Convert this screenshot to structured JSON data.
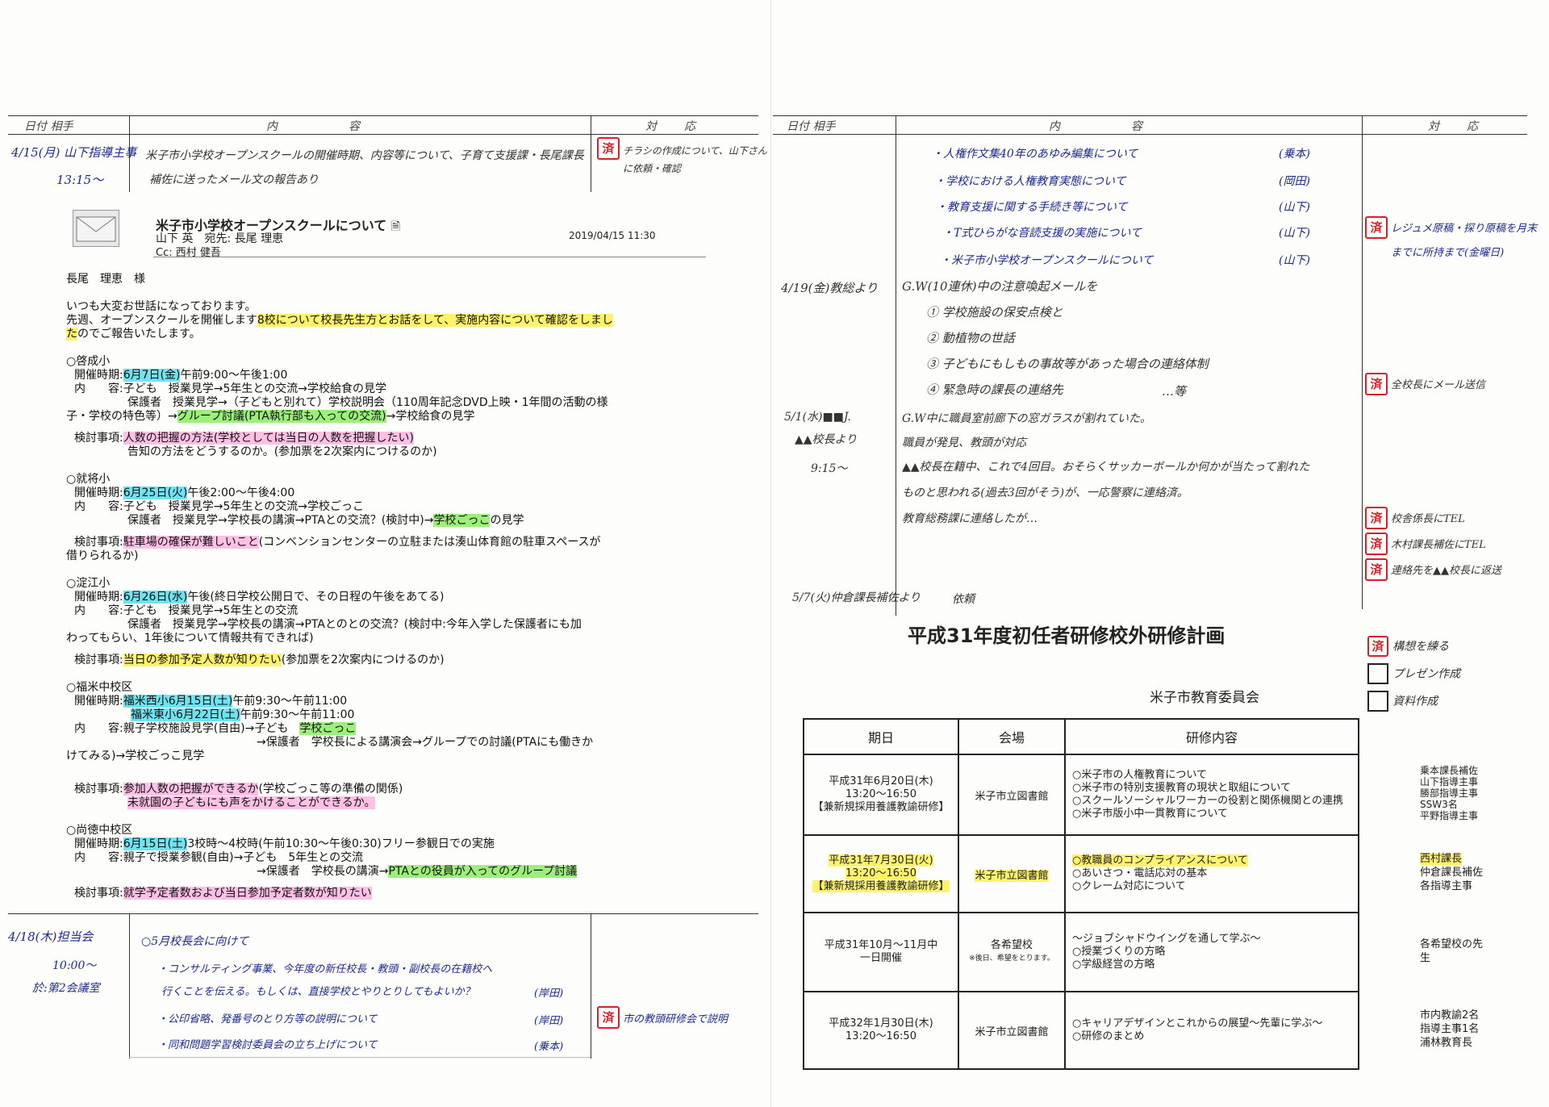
{
  "left": {
    "header": {
      "date": "日付 相手",
      "content": "内　　容",
      "response": "対　応"
    },
    "entry1": {
      "date": "4/15(月) 山下指導主事",
      "time": "13:15～",
      "line1": "米子市小学校オープンスクールの開催時期、内容等について、子育て支援課・長尾課長",
      "line2": "補佐に送ったメール文の報告あり",
      "stamp": "済",
      "resp1": "チラシの作成について、山下さん",
      "resp2": "に依頼・確認"
    },
    "email": {
      "subject": "米子市小学校オープンスクールについて",
      "from": "山下 英　宛先: 長尾 理恵",
      "cc": "Cc: 西村 健吾",
      "datetime": "2019/04/15 11:30",
      "greeting": "長尾　理恵　様",
      "body1": "いつも大変お世話になっております。",
      "body2a": "先週、オープンスクールを開催します",
      "body2b": "8校について校長先生方とお話をして、実施内容について確認をしまし",
      "body3a": "た",
      "body3b": "のでご報告いたします。",
      "s1": {
        "name": "○啓成小",
        "l1a": "開催時期:",
        "l1b": "6月7日(金)",
        "l1c": "午前9:00～午後1:00",
        "l2": "内　　容:子ども　授業見学→5年生との交流→学校給食の見学",
        "l3": "保護者　授業見学→（子どもと別れて）学校説明会（110周年記念DVD上映・1年間の活動の様",
        "l4a": "子・学校の特色等）→",
        "l4b": "グループ討議(PTA執行部も入っての交流)",
        "l4c": "→学校給食の見学",
        "k1a": "検討事項:",
        "k1b": "人数の把握の方法(学校としては当日の人数を把握したい)",
        "k2": "告知の方法をどうするのか。(参加票を2次案内につけるのか)"
      },
      "s2": {
        "name": "○就将小",
        "l1a": "開催時期:",
        "l1b": "6月25日(火)",
        "l1c": "午後2:00～午後4:00",
        "l2": "内　　容:子ども　授業見学→5年生との交流→学校ごっこ",
        "l3a": "保護者　授業見学→学校長の講演→PTAとの交流？(検討中)→",
        "l3b": "学校ごっこ",
        "l3c": "の見学",
        "k1a": "検討事項:",
        "k1b": "駐車場の確保が難しいこと",
        "k1c": "(コンベンションセンターの立駐または湊山体育館の駐車スペースが",
        "k2": "借りられるか)"
      },
      "s3": {
        "name": "○淀江小",
        "l1a": "開催時期:",
        "l1b": "6月26日(水)",
        "l1c": "午後(終日学校公開日で、その日程の午後をあてる)",
        "l2": "内　　容:子ども　授業見学→5年生との交流",
        "l3": "保護者　授業見学→学校長の講演→PTAとのとの交流？(検討中:今年入学した保護者にも加",
        "l4": "わってもらい、1年後について情報共有できれば)",
        "k1a": "検討事項:",
        "k1b": "当日の参加予定人数が知りたい",
        "k1c": "(参加票を2次案内につけるのか)"
      },
      "s4": {
        "name": "○福米中校区",
        "l1a": "開催時期:",
        "l1b": "福米西小6月15日(土)",
        "l1c": "午前9:30～午前11:00",
        "l2a": "福米東小6月22日(土)",
        "l2b": "午前9:30～午前11:00",
        "l3a": "内　　容:親子学校施設見学(自由)→子ども",
        "l3b": "学校ごっこ",
        "l4": "→保護者　学校長による講演会→グループでの討議(PTAにも働きか",
        "l5": "けてみる)→学校ごっこ見学",
        "k1a": "検討事項:",
        "k1b": "参加人数の把握ができるか",
        "k1c": "(学校ごっこ等の準備の関係)",
        "k2": "未就園の子どもにも声をかけることができるか。"
      },
      "s5": {
        "name": "○尚徳中校区",
        "l1a": "開催時期:",
        "l1b": "6月15日(土)",
        "l1c": "3校時～4校時(午前10:30～午後0:30)フリー参観日での実施",
        "l2": "内　　容:親子で授業参観(自由)→子ども　5年生との交流",
        "l3a": "→保護者　学校長の講演→",
        "l3b": "PTAとの役員が入ってのグループ討議",
        "k1a": "検討事項:",
        "k1b": "就学予定者数および当日参加予定者数が知りたい"
      }
    },
    "entry2": {
      "date": "4/18(木)担当会",
      "time": "10:00～",
      "place": "於:第2会議室",
      "title": "○5月校長会に向けて",
      "i1": "・コンサルティング事業、今年度の新任校長・教頭・副校長の在籍校へ",
      "i2": "行くことを伝える。もしくは、直接学校とやりとりしてもよいか？",
      "i2who": "(岸田)",
      "i3": "・公印省略、発番号のとり方等の説明について",
      "i3who": "(岸田)",
      "i4": "・同和問題学習検討委員会の立ち上げについて",
      "i4who": "(乗本)",
      "stamp": "済",
      "resp": "市の教頭研修会で説明"
    }
  },
  "right": {
    "header": {
      "date": "日付 相手",
      "content": "内　　容",
      "response": "対　応"
    },
    "topics": [
      {
        "text": "・人権作文集40年のあゆみ編集について",
        "who": "(乗本)"
      },
      {
        "text": "・学校における人権教育実態について",
        "who": "(岡田)"
      },
      {
        "text": "・教育支援に関する手続き等について",
        "who": "(山下)"
      },
      {
        "text": "・T式ひらがな音読支援の実施について",
        "who": "(山下)"
      },
      {
        "text": "・米子市小学校オープンスクールについて",
        "who": "(山下)"
      }
    ],
    "topics_stamp": "済",
    "topics_resp1": "レジュメ原稿・探り原稿を月末",
    "topics_resp2": "までに所持まで(金曜日)",
    "gw": {
      "date": "4/19(金)教総より",
      "l1": "G.W(10連休)中の注意喚起メールを",
      "l2": "① 学校施設の保安点検と",
      "l3": "② 動植物の世話",
      "l4": "③ 子どもにもしもの事故等があった場合の連絡体制",
      "l5": "④ 緊急時の課長の連絡先",
      "l5b": "…等",
      "stamp": "済",
      "resp": "全校長にメール送信"
    },
    "window": {
      "date1": "5/1(水)■■J.",
      "date2": "▲▲校長より",
      "time": "9:15～",
      "l1": "G.W中に職員室前廊下の窓ガラスが割れていた。",
      "l2": "職員が発見、教頭が対応",
      "l3": "▲▲校長在籍中、これで4回目。おそらくサッカーボールか何かが当たって割れた",
      "l4": "ものと思われる(過去3回がそう)が、一応警察に連絡済。",
      "l5": "教育総務課に連絡したが…",
      "r1": "校舎係長にTEL",
      "r2": "木村課長補佐にTEL",
      "r3": "連絡先を▲▲校長に返送",
      "stamp": "済"
    },
    "entry57": {
      "date": "5/7(火)仲倉課長補佐より",
      "text": "依頼"
    },
    "plan": {
      "title": "平成31年度初任者研修校外研修計画",
      "org": "米子市教育委員会",
      "checks": [
        {
          "label": "構想を練る",
          "done": true
        },
        {
          "label": "プレゼン作成",
          "done": false
        },
        {
          "label": "資料作成",
          "done": false
        }
      ],
      "check_stamp": "済",
      "headers": [
        "期日",
        "会場",
        "研修内容"
      ],
      "rows": [
        {
          "date": [
            "平成31年6月20日(木)",
            "13:20～16:50",
            "【兼新規採用養護教諭研修】"
          ],
          "venue": "米子市立図書館",
          "content": [
            "○米子市の人権教育について",
            "○米子市の特別支援教育の現状と取組について",
            "○スクールソーシャルワーカーの役割と関係機関との連携",
            "○米子市版小中一貫教育について"
          ],
          "staff": [
            "乗本課長補佐",
            "山下指導主事",
            "勝部指導主事",
            "SSW3名",
            "平野指導主事"
          ]
        },
        {
          "date": [
            "平成31年7月30日(火)",
            "13:20～16:50",
            "【兼新規採用養護教諭研修】"
          ],
          "venue": "米子市立図書館",
          "content": [
            "○教職員のコンプライアンスについて",
            "○あいさつ・電話応対の基本",
            "○クレーム対応について"
          ],
          "staff": [
            "西村課長",
            "仲倉課長補佐",
            "各指導主事"
          ]
        },
        {
          "date": [
            "平成31年10月～11月中",
            "一日開催"
          ],
          "venue": "各希望校",
          "venue_note": "※後日、希望をとります。",
          "content": [
            "～ジョブシャドウイングを通して学ぶ～",
            "○授業づくりの方略",
            "○学級経営の方略"
          ],
          "staff": [
            "各希望校の先",
            "生"
          ]
        },
        {
          "date": [
            "平成32年1月30日(木)",
            "13:20～16:50"
          ],
          "venue": "米子市立図書館",
          "content": [
            "○キャリアデザインとこれからの展望～先輩に学ぶ～",
            "○研修のまとめ"
          ],
          "staff": [
            "市内教諭2名",
            "指導主事1名",
            "浦林教育長"
          ]
        }
      ]
    }
  }
}
